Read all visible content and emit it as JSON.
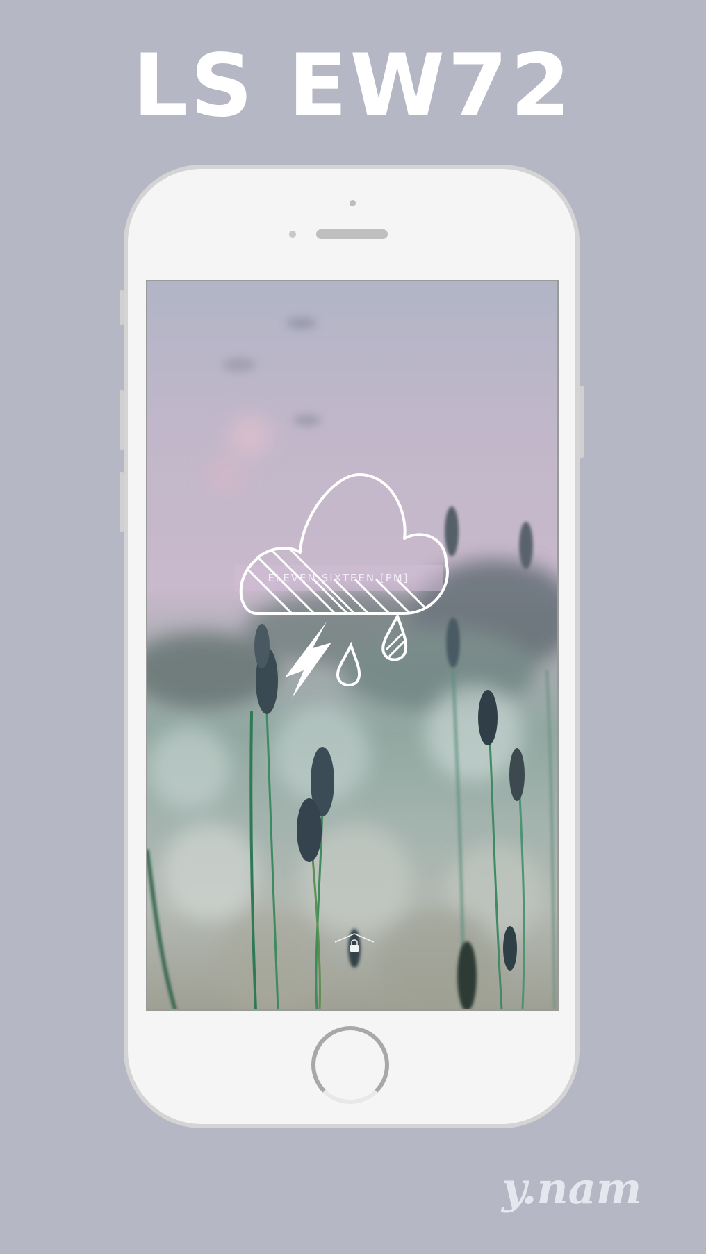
{
  "poster": {
    "title": "LS EW72",
    "signature": "y.nam"
  },
  "lockscreen": {
    "time_label": "ELEVEN:SIXTEEN [PM]",
    "weather_icon": "thunderstorm-rain-icon",
    "unlock_icon": "lock-icon"
  },
  "colors": {
    "background": "#b5b7c4",
    "phone_body": "#f5f5f5",
    "phone_border": "#d4d4d4",
    "text": "#ffffff"
  }
}
